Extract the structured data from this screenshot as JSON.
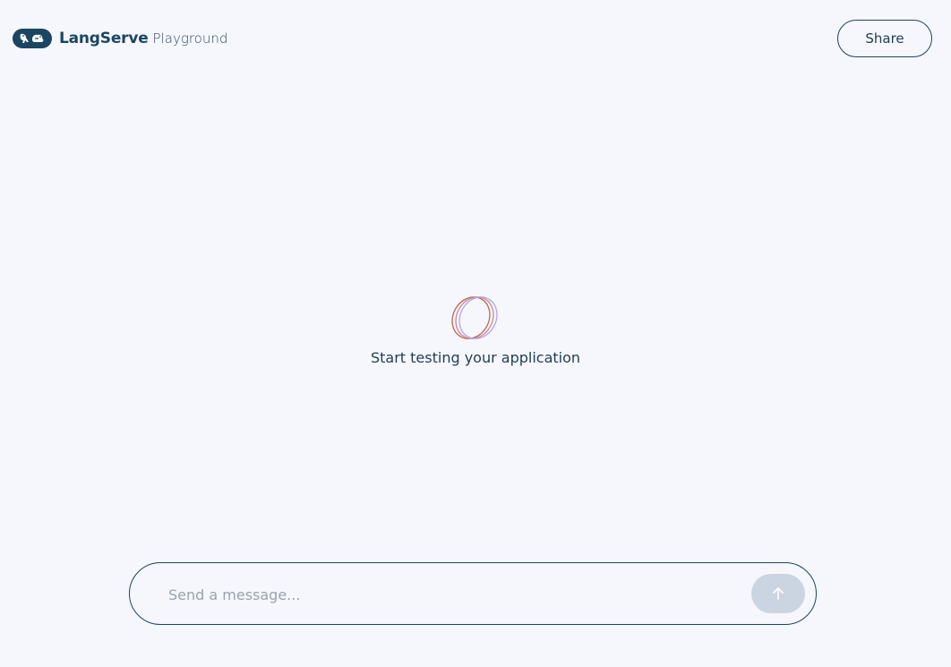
{
  "header": {
    "logo_icon": "langchain-parrot-chain-logo",
    "brand_name": "LangServe",
    "brand_sub": "Playground",
    "share_label": "Share"
  },
  "empty_state": {
    "icon": "rings-icon",
    "text": "Start testing your application"
  },
  "composer": {
    "placeholder": "Send a message...",
    "value": "",
    "send_icon": "arrow-up-icon"
  },
  "colors": {
    "background": "#f6f6fd",
    "brand": "#1b4661",
    "send_button_disabled": "#cbd5e1",
    "ring_orange": "#c8735f",
    "ring_purple": "#b9a6d9"
  }
}
